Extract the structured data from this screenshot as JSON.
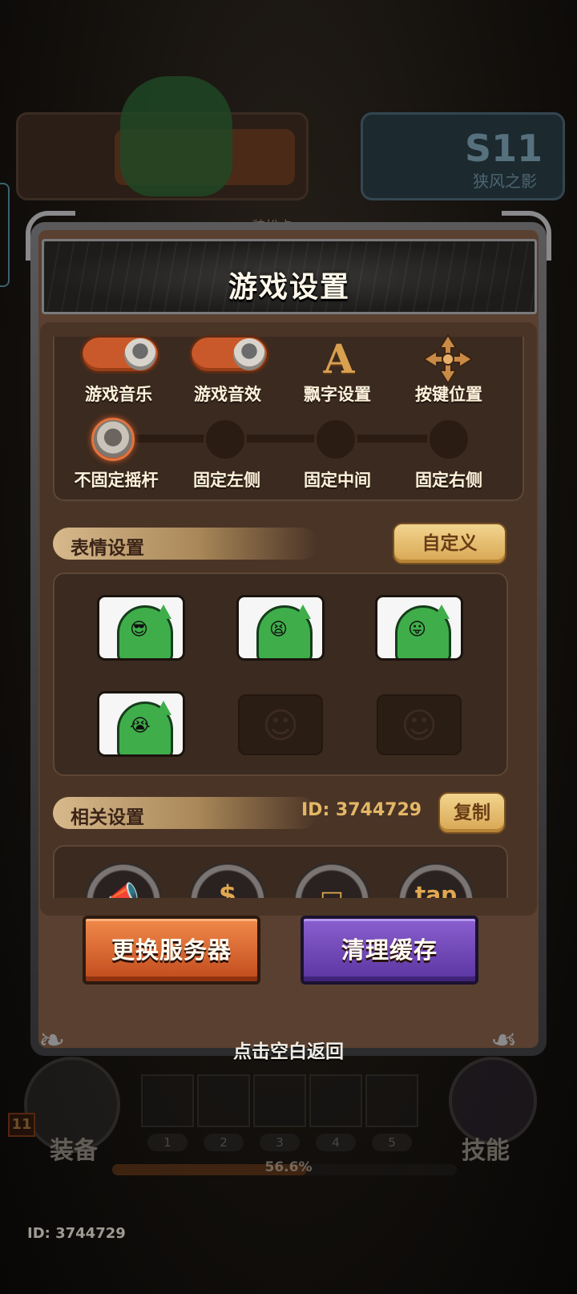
{
  "background": {
    "season_badge": "S11",
    "season_subtitle": "狭风之影",
    "card_tag": "<装扮卡>"
  },
  "dialog": {
    "title": "游戏设置",
    "toggles": [
      {
        "label": "游戏音乐",
        "on": true
      },
      {
        "label": "游戏音效",
        "on": true
      }
    ],
    "font_setting_label": "飘字设置",
    "font_setting_icon": "A",
    "key_position_label": "按键位置",
    "joystick_options": [
      "不固定摇杆",
      "固定左侧",
      "固定中间",
      "固定右侧"
    ],
    "joystick_selected": "不固定摇杆",
    "emote_section": {
      "title": "表情设置",
      "custom_button": "自定义",
      "slots": [
        {
          "name": "cool-sunglasses-emote",
          "face": "😎"
        },
        {
          "name": "angry-shout-emote",
          "face": "😫"
        },
        {
          "name": "tongue-out-emote",
          "face": "😛"
        },
        {
          "name": "crying-emote",
          "face": "😭"
        },
        {
          "name": "empty-slot",
          "face": "☺"
        },
        {
          "name": "empty-slot",
          "face": "☺"
        }
      ]
    },
    "related_section": {
      "title": "相关设置",
      "id_text": "ID: 3744729",
      "copy_button": "复制",
      "icons": [
        "megaphone-icon",
        "coin-icon",
        "card-icon",
        "tap"
      ]
    },
    "change_server_button": "更换服务器",
    "clear_cache_button": "清理缓存",
    "tap_blank_hint": "点击空白返回"
  },
  "hud": {
    "level": "11",
    "equip_label": "装备",
    "skill_label": "技能",
    "slot_numbers": [
      "1",
      "2",
      "3",
      "4",
      "5"
    ],
    "xp_text": "56.6%",
    "xp_fraction": 0.566
  },
  "footer": {
    "id_text": "ID: 3744729"
  },
  "colors": {
    "panel_brown": "#5a4030",
    "accent_orange": "#c9592a",
    "gold": "#d7a652",
    "purple": "#6b45b5"
  }
}
